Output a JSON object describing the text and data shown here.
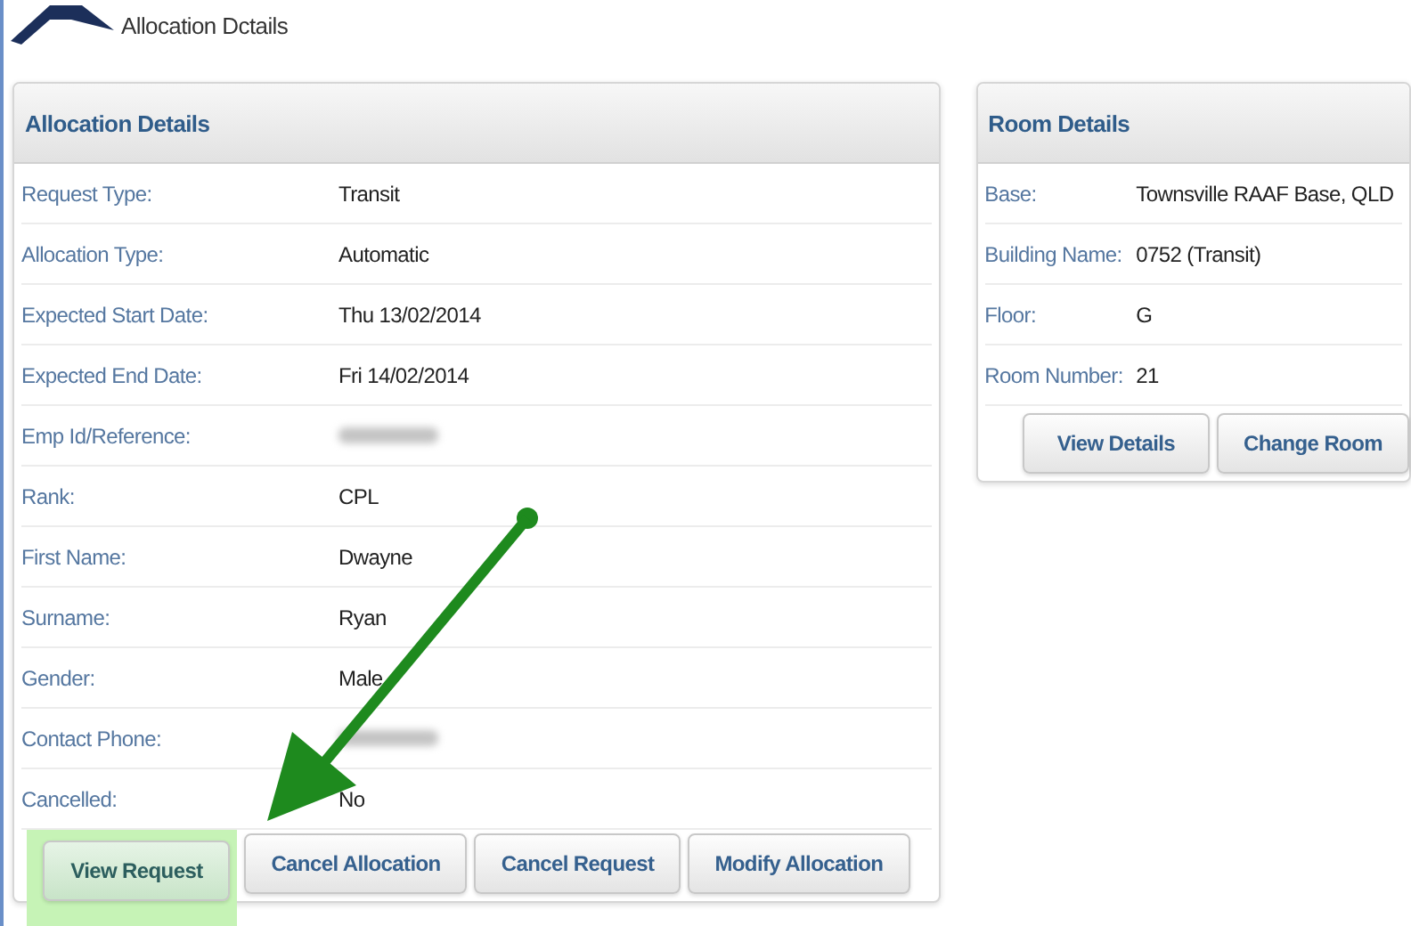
{
  "page": {
    "title": "Allocation Dctails"
  },
  "allocation_details": {
    "title": "Allocation Details",
    "fields": [
      {
        "label": "Request Type:",
        "value": "Transit"
      },
      {
        "label": "Allocation Type:",
        "value": "Automatic"
      },
      {
        "label": "Expected Start Date:",
        "value": "Thu 13/02/2014"
      },
      {
        "label": "Expected End Date:",
        "value": "Fri 14/02/2014"
      },
      {
        "label": "Emp Id/Reference:",
        "redacted": true
      },
      {
        "label": "Rank:",
        "value": "CPL"
      },
      {
        "label": "First Name:",
        "value": "Dwayne"
      },
      {
        "label": "Surname:",
        "value": "Ryan"
      },
      {
        "label": "Gender:",
        "value": "Male"
      },
      {
        "label": "Contact Phone:",
        "redacted": true
      },
      {
        "label": "Cancelled:",
        "value": "No"
      }
    ],
    "buttons": [
      {
        "label": "View Request",
        "highlighted": true
      },
      {
        "label": "Cancel Allocation",
        "highlighted": false
      },
      {
        "label": "Cancel Request",
        "highlighted": false
      },
      {
        "label": "Modify Allocation",
        "highlighted": false
      }
    ]
  },
  "room_details": {
    "title": "Room Details",
    "fields": [
      {
        "label": "Base:",
        "value": "Townsville RAAF Base, QLD"
      },
      {
        "label": "Building Name:",
        "value": "0752 (Transit)"
      },
      {
        "label": "Floor:",
        "value": "G"
      },
      {
        "label": "Room Number:",
        "value": "21"
      }
    ],
    "buttons": [
      {
        "label": "View Details",
        "highlighted": false
      },
      {
        "label": "Change Room",
        "highlighted": false
      }
    ]
  }
}
